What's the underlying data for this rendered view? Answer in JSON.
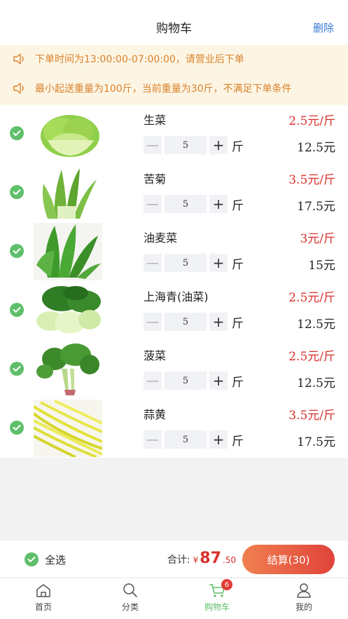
{
  "header": {
    "title": "购物车",
    "delete_label": "删除"
  },
  "notices": [
    {
      "icon": "speaker-icon",
      "text": "下单时间为13:00:00-07:00:00，请营业后下单"
    },
    {
      "icon": "speaker-icon",
      "text": "最小起送重量为100斤，当前重量为30斤，不满足下单条件"
    }
  ],
  "items": [
    {
      "name": "生菜",
      "price": "2.5元/斤",
      "qty": "5",
      "unit": "斤",
      "subtotal": "12.5元",
      "checked": true
    },
    {
      "name": "苦菊",
      "price": "3.5元/斤",
      "qty": "5",
      "unit": "斤",
      "subtotal": "17.5元",
      "checked": true
    },
    {
      "name": "油麦菜",
      "price": "3元/斤",
      "qty": "5",
      "unit": "斤",
      "subtotal": "15元",
      "checked": true
    },
    {
      "name": "上海青(油菜)",
      "price": "2.5元/斤",
      "qty": "5",
      "unit": "斤",
      "subtotal": "12.5元",
      "checked": true
    },
    {
      "name": "菠菜",
      "price": "2.5元/斤",
      "qty": "5",
      "unit": "斤",
      "subtotal": "12.5元",
      "checked": true
    },
    {
      "name": "蒜黄",
      "price": "3.5元/斤",
      "qty": "5",
      "unit": "斤",
      "subtotal": "17.5元",
      "checked": true
    }
  ],
  "stepper": {
    "minus": "—",
    "plus": "+"
  },
  "footer": {
    "select_all_label": "全选",
    "total_label": "合计:",
    "currency": "¥",
    "total_integer": "87",
    "total_decimal": ".50",
    "checkout_label": "结算(30)"
  },
  "tabs": [
    {
      "label": "首页",
      "icon": "home-icon",
      "active": false
    },
    {
      "label": "分类",
      "icon": "search-icon",
      "active": false
    },
    {
      "label": "购物车",
      "icon": "cart-icon",
      "active": true,
      "badge": "6"
    },
    {
      "label": "我的",
      "icon": "user-icon",
      "active": false
    }
  ],
  "colors": {
    "accent_green": "#5fbf6a",
    "price_red": "#d9302c",
    "notice_orange": "#d9822b",
    "notice_bg": "#fdf5e4",
    "link_blue": "#3a7bd5"
  }
}
